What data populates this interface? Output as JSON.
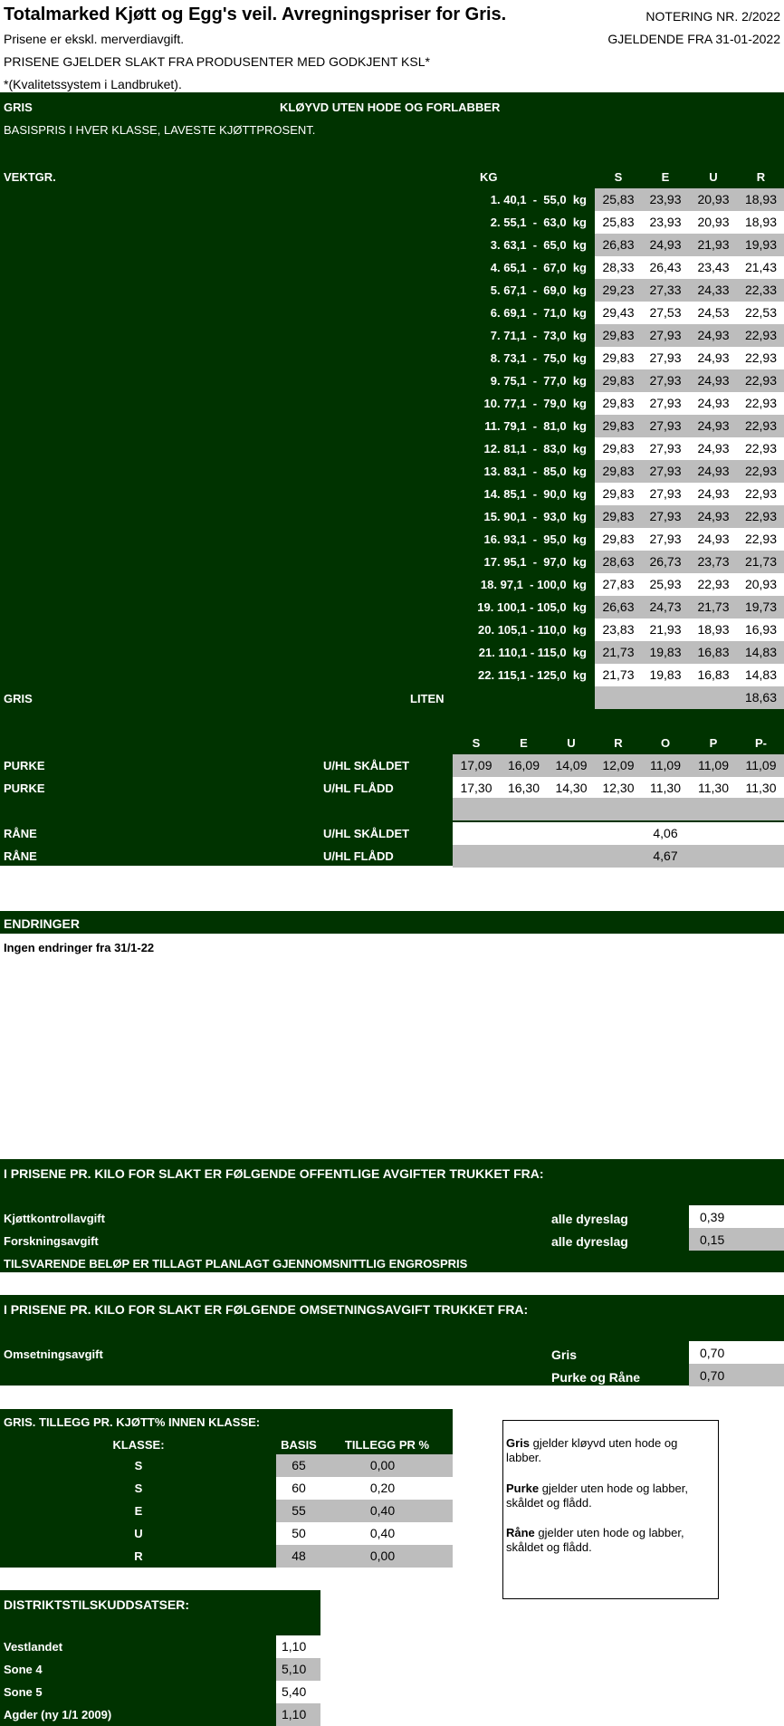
{
  "header": {
    "title": "Totalmarked Kjøtt og Egg's veil. Avregningspriser for Gris.",
    "notering": "NOTERING NR. 2/2022",
    "gjeldende": "GJELDENDE FRA 31-01-2022",
    "line1": "Prisene er ekskl. merverdiavgift.",
    "line2": "PRISENE GJELDER SLAKT FRA PRODUSENTER MED GODKJENT KSL*",
    "line3": "*(Kvalitetssystem i Landbruket)."
  },
  "gris": {
    "label": "GRIS",
    "subtitle": "KLØYVD UTEN HODE OG FORLABBER",
    "basis_text": "BASISPRIS I HVER KLASSE, LAVESTE KJØTTPROSENT.",
    "vektgr_label": "VEKTGR.",
    "kg_label": "KG",
    "classes": [
      "S",
      "E",
      "U",
      "R"
    ],
    "rows": [
      {
        "kg": "1. 40,1  -  55,0  kg",
        "v": [
          "25,83",
          "23,93",
          "20,93",
          "18,93"
        ]
      },
      {
        "kg": "2. 55,1  -  63,0  kg",
        "v": [
          "25,83",
          "23,93",
          "20,93",
          "18,93"
        ]
      },
      {
        "kg": "3. 63,1  -  65,0  kg",
        "v": [
          "26,83",
          "24,93",
          "21,93",
          "19,93"
        ]
      },
      {
        "kg": "4. 65,1  -  67,0  kg",
        "v": [
          "28,33",
          "26,43",
          "23,43",
          "21,43"
        ]
      },
      {
        "kg": "5. 67,1  -  69,0  kg",
        "v": [
          "29,23",
          "27,33",
          "24,33",
          "22,33"
        ]
      },
      {
        "kg": "6. 69,1  -  71,0  kg",
        "v": [
          "29,43",
          "27,53",
          "24,53",
          "22,53"
        ]
      },
      {
        "kg": "7. 71,1  -  73,0  kg",
        "v": [
          "29,83",
          "27,93",
          "24,93",
          "22,93"
        ]
      },
      {
        "kg": "8. 73,1  -  75,0  kg",
        "v": [
          "29,83",
          "27,93",
          "24,93",
          "22,93"
        ]
      },
      {
        "kg": "9. 75,1  -  77,0  kg",
        "v": [
          "29,83",
          "27,93",
          "24,93",
          "22,93"
        ]
      },
      {
        "kg": "10. 77,1  -  79,0  kg",
        "v": [
          "29,83",
          "27,93",
          "24,93",
          "22,93"
        ]
      },
      {
        "kg": "11. 79,1  -  81,0  kg",
        "v": [
          "29,83",
          "27,93",
          "24,93",
          "22,93"
        ]
      },
      {
        "kg": "12. 81,1  -  83,0  kg",
        "v": [
          "29,83",
          "27,93",
          "24,93",
          "22,93"
        ]
      },
      {
        "kg": "13. 83,1  -  85,0  kg",
        "v": [
          "29,83",
          "27,93",
          "24,93",
          "22,93"
        ]
      },
      {
        "kg": "14. 85,1  -  90,0  kg",
        "v": [
          "29,83",
          "27,93",
          "24,93",
          "22,93"
        ]
      },
      {
        "kg": "15. 90,1  -  93,0  kg",
        "v": [
          "29,83",
          "27,93",
          "24,93",
          "22,93"
        ]
      },
      {
        "kg": "16. 93,1  -  95,0  kg",
        "v": [
          "29,83",
          "27,93",
          "24,93",
          "22,93"
        ]
      },
      {
        "kg": "17. 95,1  -  97,0  kg",
        "v": [
          "28,63",
          "26,73",
          "23,73",
          "21,73"
        ]
      },
      {
        "kg": "18. 97,1  - 100,0  kg",
        "v": [
          "27,83",
          "25,93",
          "22,93",
          "20,93"
        ]
      },
      {
        "kg": "19. 100,1 - 105,0  kg",
        "v": [
          "26,63",
          "24,73",
          "21,73",
          "19,73"
        ]
      },
      {
        "kg": "20. 105,1 - 110,0  kg",
        "v": [
          "23,83",
          "21,93",
          "18,93",
          "16,93"
        ]
      },
      {
        "kg": "21. 110,1 - 115,0  kg",
        "v": [
          "21,73",
          "19,83",
          "16,83",
          "14,83"
        ]
      },
      {
        "kg": "22. 115,1 - 125,0  kg",
        "v": [
          "21,73",
          "19,83",
          "16,83",
          "14,83"
        ]
      }
    ],
    "liten_label": "GRIS",
    "liten": "LITEN",
    "liten_value": "18,63"
  },
  "purke": {
    "classes": [
      "S",
      "E",
      "U",
      "R",
      "O",
      "P",
      "P-"
    ],
    "rows": [
      {
        "name": "PURKE",
        "type": "U/HL SKÅLDET",
        "v": [
          "17,09",
          "16,09",
          "14,09",
          "12,09",
          "11,09",
          "11,09",
          "11,09"
        ]
      },
      {
        "name": "PURKE",
        "type": "U/HL FLÅDD",
        "v": [
          "17,30",
          "16,30",
          "14,30",
          "12,30",
          "11,30",
          "11,30",
          "11,30"
        ]
      }
    ]
  },
  "rane": {
    "rows": [
      {
        "name": "RÅNE",
        "type": "U/HL SKÅLDET",
        "value": "4,06"
      },
      {
        "name": "RÅNE",
        "type": "U/HL FLÅDD",
        "value": "4,67"
      }
    ]
  },
  "endringer": {
    "title": "ENDRINGER",
    "text": "Ingen endringer fra 31/1-22"
  },
  "avgifter": {
    "title": "I PRISENE PR. KILO FOR SLAKT ER FØLGENDE OFFENTLIGE AVGIFTER TRUKKET FRA:",
    "rows": [
      {
        "name": "Kjøttkontrollavgift",
        "scope": "alle dyreslag",
        "value": "0,39"
      },
      {
        "name": "Forskningsavgift",
        "scope": "alle dyreslag",
        "value": "0,15"
      }
    ],
    "note": "TILSVARENDE BELØP ER TILLAGT PLANLAGT GJENNOMSNITTLIG ENGROSPRIS"
  },
  "omsetning": {
    "title": "I PRISENE PR. KILO FOR SLAKT ER FØLGENDE OMSETNINGSAVGIFT TRUKKET FRA:",
    "name": "Omsetningsavgift",
    "rows": [
      {
        "scope": "Gris",
        "value": "0,70"
      },
      {
        "scope": "Purke og Råne",
        "value": "0,70"
      }
    ]
  },
  "tillegg": {
    "title": "GRIS. TILLEGG PR. KJØTT% INNEN KLASSE:",
    "col_klasse": "KLASSE:",
    "col_basis": "BASIS",
    "col_tillegg": "TILLEGG PR %",
    "rows": [
      {
        "k": "S",
        "basis": "65",
        "tillegg": "0,00"
      },
      {
        "k": "S",
        "basis": "60",
        "tillegg": "0,20"
      },
      {
        "k": "E",
        "basis": "55",
        "tillegg": "0,40"
      },
      {
        "k": "U",
        "basis": "50",
        "tillegg": "0,40"
      },
      {
        "k": "R",
        "basis": "48",
        "tillegg": "0,00"
      }
    ]
  },
  "notes": {
    "gris_bold": "Gris",
    "gris_text": " gjelder kløyvd uten hode og labber.",
    "purke_bold": "Purke",
    "purke_text": " gjelder uten hode og labber, skåldet og flådd.",
    "rane_bold": "Råne",
    "rane_text": " gjelder uten hode og labber, skåldet og flådd."
  },
  "distrikt": {
    "title": "DISTRIKTSTILSKUDDSATSER:",
    "rows": [
      {
        "name": "Vestlandet",
        "value": "1,10"
      },
      {
        "name": "Sone 4",
        "value": "5,10"
      },
      {
        "name": "Sone 5",
        "value": "5,40"
      },
      {
        "name": "Agder (ny 1/1 2009)",
        "value": "1,10"
      }
    ]
  }
}
